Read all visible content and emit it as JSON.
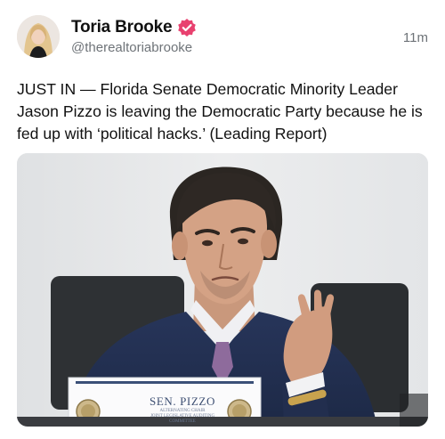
{
  "post": {
    "author": {
      "display_name": "Toria Brooke",
      "handle": "@therealtoriabrooke",
      "verified": true,
      "badge_color": "#e8416f"
    },
    "timestamp": "11m",
    "text": "JUST IN — Florida Senate Democratic Minority Leader Jason Pizzo is leaving the Democratic Party because he is fed up with ‘political hacks.’ (Leading Report)",
    "media": {
      "placard": {
        "title": "SEN. PIZZO",
        "subtitle_line1": "ALTERNATING CHAIR",
        "subtitle_line2": "JOINT LEGISLATIVE AUDITING COMMITTEE"
      }
    }
  }
}
